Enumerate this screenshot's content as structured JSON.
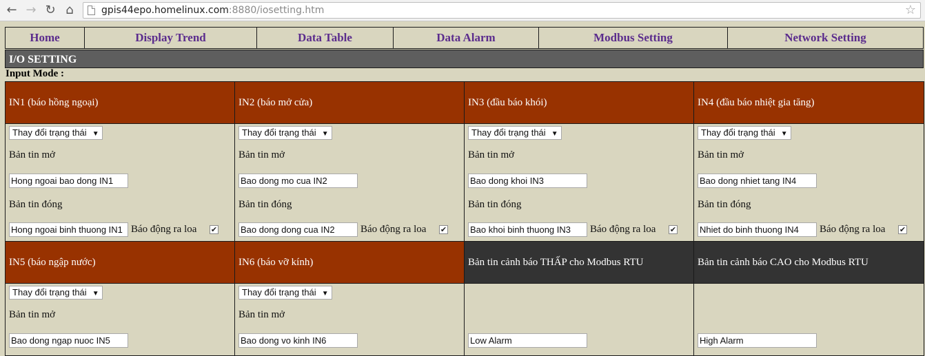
{
  "browser": {
    "url_host": "gpis44epo.homelinux.com",
    "url_rest": ":8880/iosetting.htm"
  },
  "menu": [
    "Home",
    "Display Trend",
    "Data Table",
    "Data Alarm",
    "Modbus Setting",
    "Network Setting"
  ],
  "section_title": "I/O SETTING",
  "input_mode_label": "Input Mode :",
  "inputs": [
    {
      "title": "IN1 (báo hồng ngoại)",
      "mode": "Thay đổi trạng thái",
      "open_label": "Bản tin mở",
      "open_msg": "Hong ngoai bao dong IN1",
      "close_label": "Bản tin đóng",
      "close_msg": "Hong ngoai binh thuong IN1",
      "alarm_label": "Báo động ra loa",
      "alarm_checked": true
    },
    {
      "title": "IN2 (báo mở cửa)",
      "mode": "Thay đổi trạng thái",
      "open_label": "Bản tin mở",
      "open_msg": "Bao dong mo cua IN2",
      "close_label": "Bản tin đóng",
      "close_msg": "Bao dong dong cua IN2",
      "alarm_label": "Báo động ra loa",
      "alarm_checked": true
    },
    {
      "title": "IN3 (đầu báo khói)",
      "mode": "Thay đổi trạng thái",
      "open_label": "Bản tin mở",
      "open_msg": "Bao dong khoi IN3",
      "close_label": "Bản tin đóng",
      "close_msg": "Bao khoi binh thuong IN3",
      "alarm_label": "Báo động ra loa",
      "alarm_checked": true
    },
    {
      "title": "IN4 (đầu báo nhiệt gia tăng)",
      "mode": "Thay đổi trạng thái",
      "open_label": "Bản tin mở",
      "open_msg": "Bao dong nhiet tang IN4",
      "close_label": "Bản tin đóng",
      "close_msg": "Nhiet do binh thuong IN4",
      "alarm_label": "Báo động ra loa",
      "alarm_checked": true
    },
    {
      "title": "IN5 (báo ngập nước)",
      "mode": "Thay đổi trạng thái",
      "open_label": "Bản tin mở",
      "open_msg": "Bao dong ngap nuoc IN5"
    },
    {
      "title": "IN6 (báo vỡ kính)",
      "mode": "Thay đổi trạng thái",
      "open_label": "Bản tin mở",
      "open_msg": "Bao dong vo kinh IN6"
    }
  ],
  "modbus": {
    "low_title": "Bản tin cảnh báo THẤP cho Modbus RTU",
    "low_msg": "Low Alarm",
    "high_title": "Bản tin cảnh báo CAO cho Modbus RTU",
    "high_msg": "High Alarm"
  },
  "colors": {
    "input_header": "#983200",
    "modbus_header": "#333333",
    "menu_text": "#5b2c8d",
    "page_bg": "#d9d6bf"
  },
  "icons": [
    "back-arrow-icon",
    "forward-arrow-icon",
    "reload-icon",
    "home-icon",
    "page-icon",
    "bookmark-star-icon",
    "dropdown-arrow-icon",
    "checkmark-icon"
  ]
}
